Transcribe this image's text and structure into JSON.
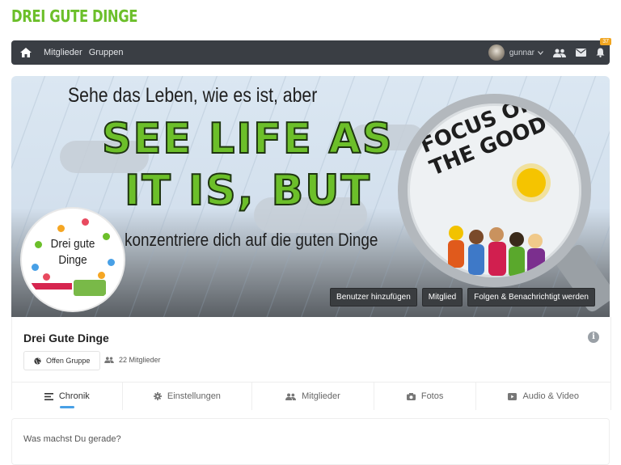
{
  "site": {
    "logo": "DREI GUTE DINGE"
  },
  "navbar": {
    "links": [
      "Mitglieder",
      "Gruppen"
    ],
    "username": "gunnar",
    "notification_count": "37"
  },
  "cover": {
    "line1": "Sehe das Leben, wie es ist, aber",
    "line2": "SEE LIFE AS",
    "line3": "IT IS, BUT",
    "line4": "konzentriere dich auf die guten Dinge",
    "lens_line1": "FOCUS ON",
    "lens_line2": "THE GOOD BITS",
    "profile_title1": "Drei gute",
    "profile_title2": "Dinge",
    "buttons": [
      "Benutzer hinzufügen",
      "Mitglied",
      "Folgen & Benachrichtigt werden"
    ]
  },
  "group": {
    "name": "Drei Gute Dinge",
    "type": "Offen Gruppe",
    "members": "22 Mitglieder"
  },
  "tabs": [
    {
      "label": "Chronik",
      "icon": "list-icon"
    },
    {
      "label": "Einstellungen",
      "icon": "gear-icon"
    },
    {
      "label": "Mitglieder",
      "icon": "users-icon"
    },
    {
      "label": "Fotos",
      "icon": "camera-icon"
    },
    {
      "label": "Audio & Video",
      "icon": "video-icon"
    }
  ],
  "composer": {
    "placeholder": "Was machst Du gerade?"
  },
  "colors": {
    "brand_green": "#6cbf2a",
    "navbar": "#3a3e44",
    "badge": "#f0a520",
    "tab_indicator": "#48a0e6"
  }
}
